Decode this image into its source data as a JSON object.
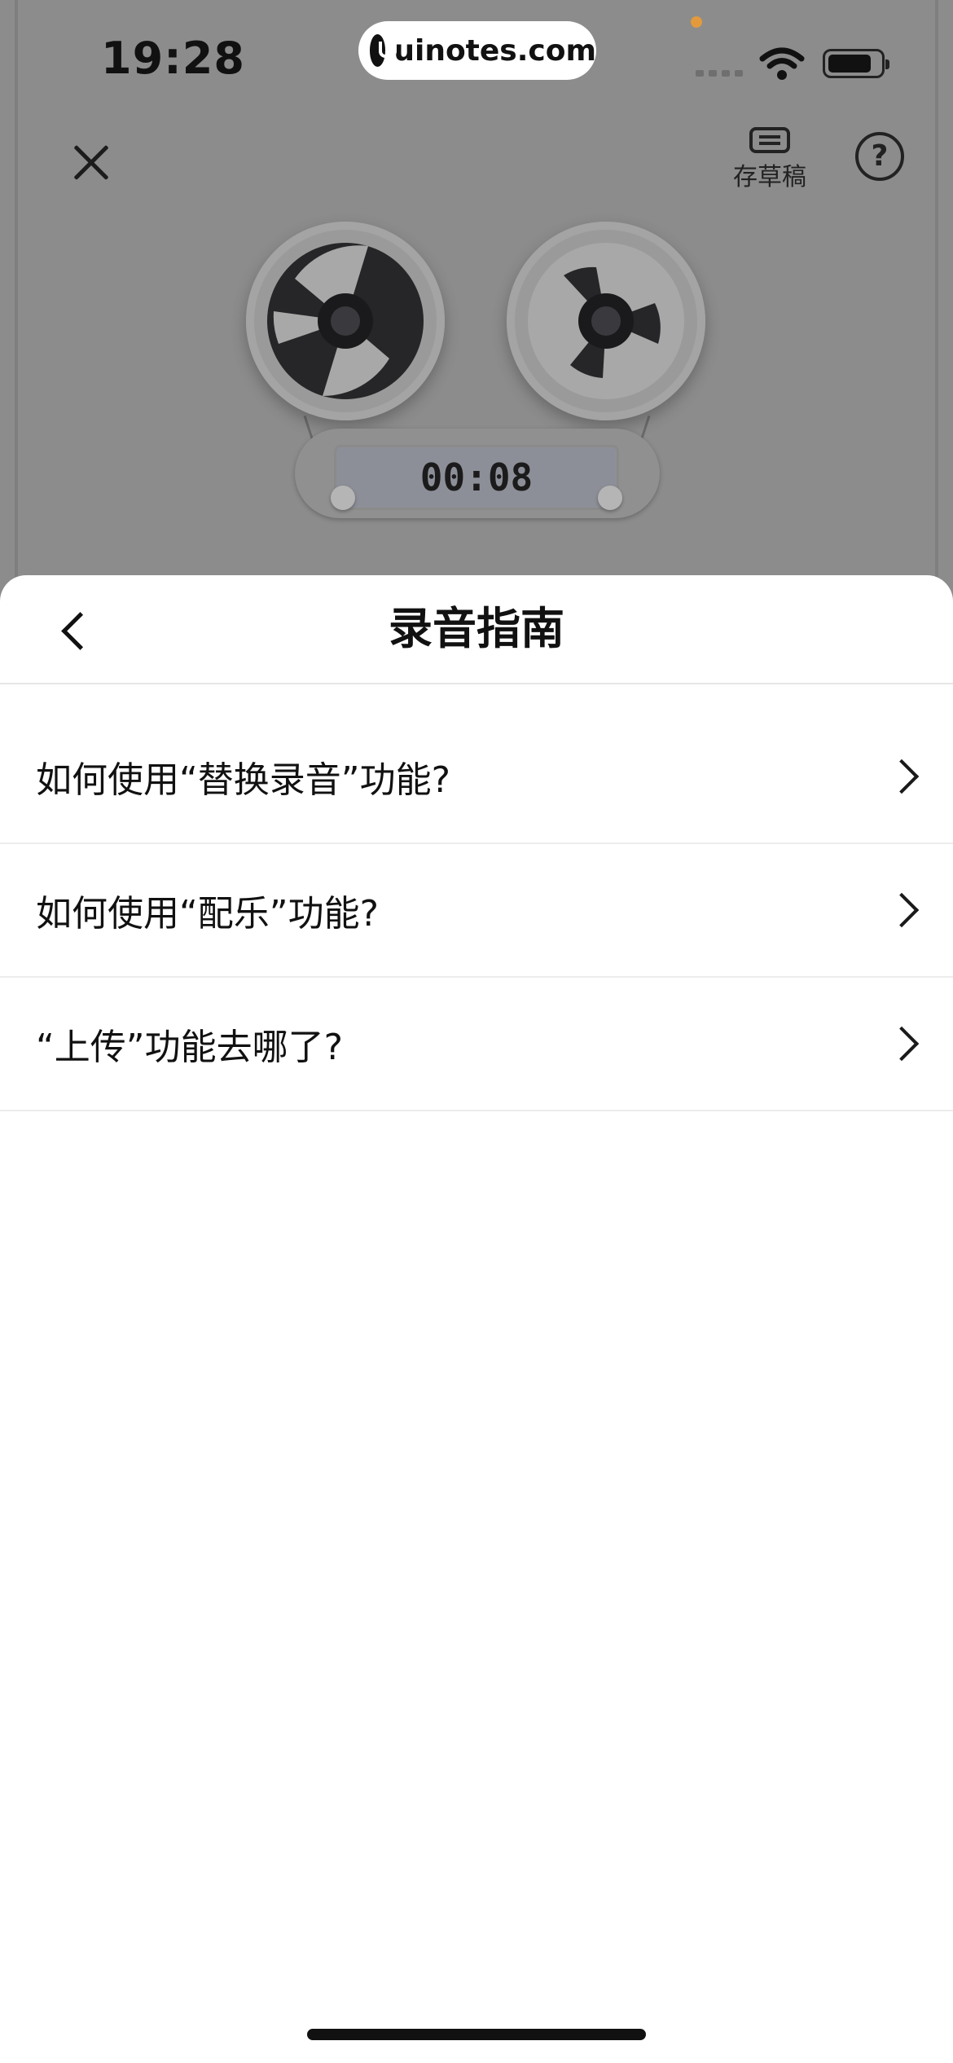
{
  "status_bar": {
    "time": "19:28",
    "watermark": "uinotes.com"
  },
  "recorder": {
    "draft_label": "存草稿",
    "help_symbol": "?",
    "timer": "00:08"
  },
  "sheet": {
    "title": "录音指南",
    "items": [
      {
        "label": "如何使用“替换录音”功能?"
      },
      {
        "label": "如何使用“配乐”功能?"
      },
      {
        "label": "“上传”功能去哪了?"
      }
    ]
  },
  "icons": {
    "close": "close-icon",
    "draft": "draft-icon",
    "help": "help-icon",
    "back": "back-arrow-icon",
    "chevron": "chevron-right-icon"
  },
  "colors": {
    "overlay": "#8c8c8c",
    "sheet_bg": "#ffffff",
    "text": "#111111",
    "divider": "#ececec"
  }
}
